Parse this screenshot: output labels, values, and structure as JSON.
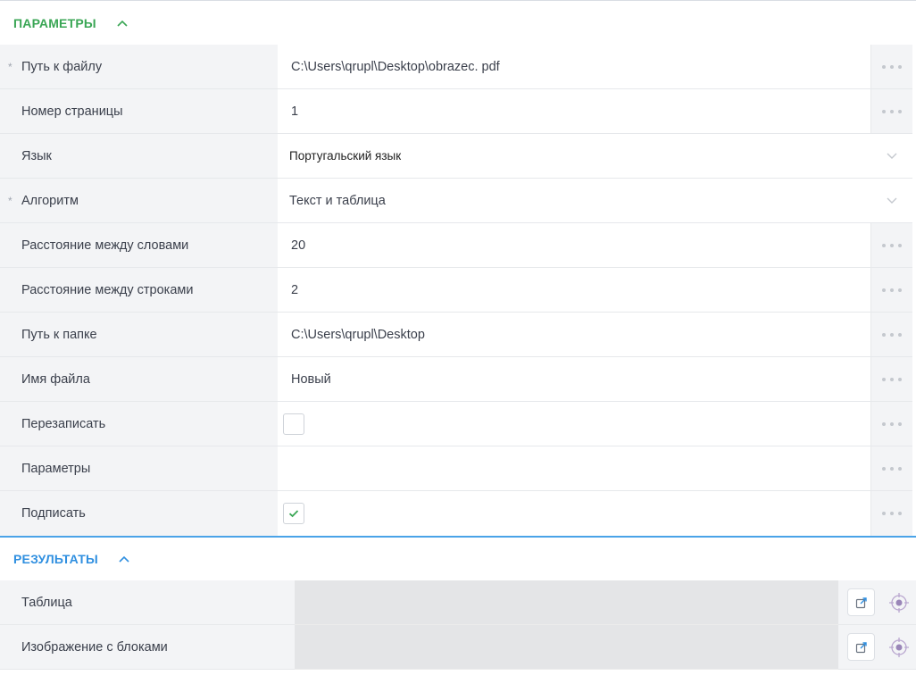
{
  "parameters": {
    "title": "ПАРАМЕТРЫ",
    "rows": [
      {
        "label": "Путь к файлу",
        "required": true,
        "value": "C:\\Users\\qrupl\\Desktop\\obrazec. pdf",
        "kind": "text"
      },
      {
        "label": "Номер страницы",
        "required": false,
        "value": "1",
        "kind": "text"
      },
      {
        "label": "Язык",
        "required": false,
        "value": "Португальский язык",
        "kind": "select"
      },
      {
        "label": "Алгоритм",
        "required": true,
        "value": "Текст и таблица",
        "kind": "select"
      },
      {
        "label": "Расстояние между словами",
        "required": false,
        "value": "20",
        "kind": "text"
      },
      {
        "label": "Расстояние между строками",
        "required": false,
        "value": "2",
        "kind": "text"
      },
      {
        "label": "Путь к папке",
        "required": false,
        "value": "C:\\Users\\qrupl\\Desktop",
        "kind": "text"
      },
      {
        "label": "Имя файла",
        "required": false,
        "value": "Новый",
        "kind": "text"
      },
      {
        "label": "Перезаписать",
        "required": false,
        "checked": false,
        "kind": "checkbox"
      },
      {
        "label": "Параметры",
        "required": false,
        "value": "",
        "kind": "text"
      },
      {
        "label": "Подписать",
        "required": false,
        "checked": true,
        "kind": "checkbox"
      }
    ]
  },
  "results": {
    "title": "РЕЗУЛЬТАТЫ",
    "rows": [
      {
        "label": "Таблица"
      },
      {
        "label": "Изображение с блоками"
      }
    ]
  },
  "required_marker": "*",
  "colors": {
    "params_title": "#3aa655",
    "results_title": "#2f8fe0",
    "results_divider": "#4aa3e8",
    "checkmark": "#3aa655",
    "label_bg": "#f3f4f6",
    "result_value_bg": "#e4e5e7"
  },
  "icons": {
    "collapse": "chevron-up-icon",
    "more": "more-dots-icon",
    "dropdown": "chevron-down-icon",
    "export": "export-icon",
    "locate": "target-icon"
  }
}
